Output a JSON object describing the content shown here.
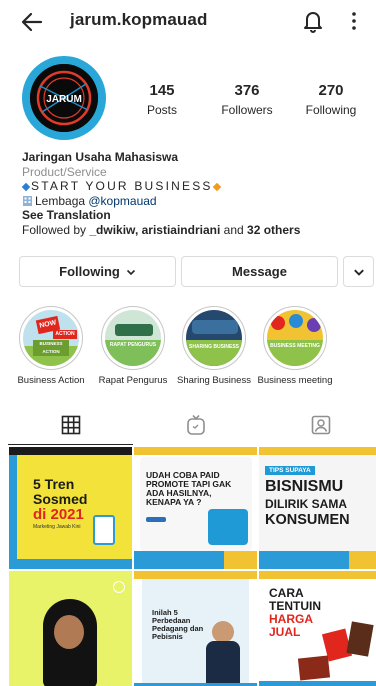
{
  "header": {
    "username": "jarum.kopmauad"
  },
  "stats": [
    {
      "value": "145",
      "label": "Posts"
    },
    {
      "value": "376",
      "label": "Followers"
    },
    {
      "value": "270",
      "label": "Following"
    }
  ],
  "avatar": {
    "text": "JARUM"
  },
  "bio": {
    "name": "Jaringan Usaha Mahasiswa",
    "category": "Product/Service",
    "tagline": "START YOUR BUSINESS",
    "org_prefix": "Lembaga ",
    "org_link": "@kopmauad",
    "see_translation": "See Translation",
    "followed_prefix": "Followed by ",
    "followed_names": "_dwikiw, aristiaindriani",
    "followed_and": " and ",
    "followed_others": "32 others"
  },
  "buttons": {
    "following": "Following",
    "message": "Message"
  },
  "highlights": [
    {
      "label": "Business Action",
      "badge_top": "NOW",
      "badge_sub": "ACTION",
      "badge_bottom": "BUSINESS ACTION"
    },
    {
      "label": "Rapat Pengurus",
      "badge": "RAPAT PENGURUS"
    },
    {
      "label": "Sharing Business",
      "badge": "SHARING BUSINESS"
    },
    {
      "label": "Business meeting",
      "badge": "BUSINESS MEETING"
    }
  ],
  "posts": [
    {
      "title_line1": "5 Tren",
      "title_line2": "Sosmed",
      "title_line3": "di 2021",
      "subtitle": "Marketing Jawab Kini"
    },
    {
      "text": "UDAH COBA PAID PROMOTE TAPI GAK ADA HASILNYA, KENAPA YA ?"
    },
    {
      "tag": "TIPS SUPAYA",
      "line1": "BISNISMU",
      "line2": "DILIRIK SAMA",
      "line3": "KONSUMEN"
    },
    {
      "kind": "video"
    },
    {
      "text": "Inilah 5 Perbedaan Pedagang dan Pebisnis"
    },
    {
      "line1": "CARA",
      "line2": "TENTUIN",
      "line3": "HARGA",
      "line4": "JUAL"
    }
  ],
  "colors": {
    "accent_blue": "#1f9ad6",
    "brand_yellow": "#f5c400",
    "link": "#00376b",
    "gray_text": "#8e8e8e",
    "border": "#dbdbdb"
  }
}
